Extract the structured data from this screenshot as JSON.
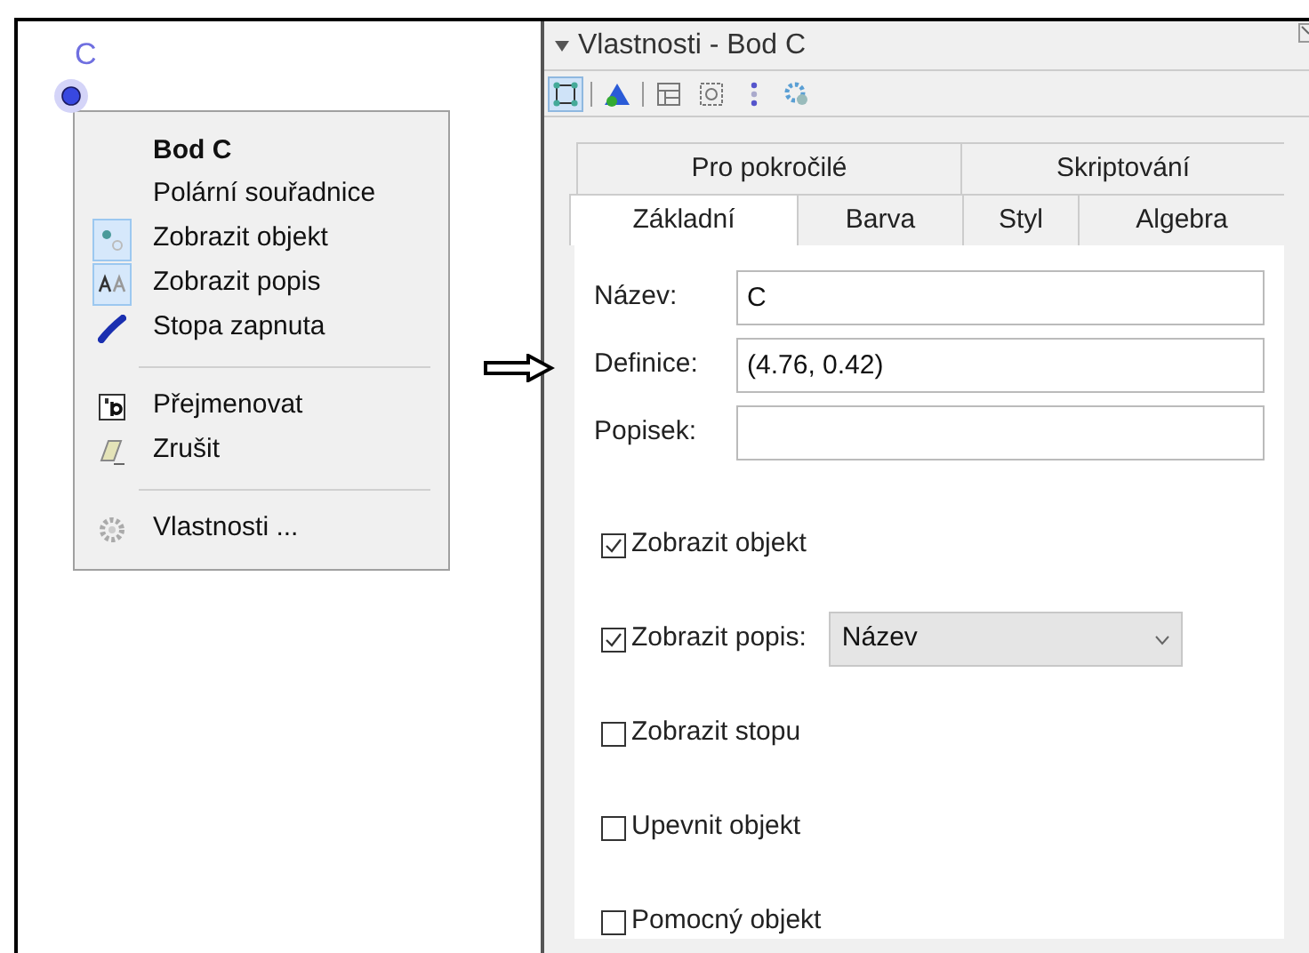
{
  "canvas": {
    "point_label": "C"
  },
  "context_menu": {
    "items": [
      {
        "kind": "title",
        "label": "Bod C"
      },
      {
        "kind": "plain",
        "label": "Polární souřadnice"
      },
      {
        "kind": "toggle",
        "label": "Zobrazit objekt",
        "checked": true
      },
      {
        "kind": "toggle",
        "label": "Zobrazit popis",
        "checked": true
      },
      {
        "kind": "toggle",
        "label": "Stopa zapnuta",
        "checked": false
      },
      {
        "kind": "separator"
      },
      {
        "kind": "action",
        "label": "Přejmenovat"
      },
      {
        "kind": "action",
        "label": "Zrušit"
      },
      {
        "kind": "separator"
      },
      {
        "kind": "action",
        "label": "Vlastnosti ..."
      }
    ]
  },
  "properties": {
    "title": "Vlastnosti - Bod C",
    "toolbar": [
      {
        "selected": true
      },
      {
        "selected": false
      },
      {
        "selected": false
      },
      {
        "selected": false
      },
      {
        "selected": false
      },
      {
        "selected": false
      }
    ],
    "tab_rows": [
      [
        {
          "label": "Pro pokročilé",
          "selected": false
        },
        {
          "label": "Skriptování",
          "selected": false
        }
      ],
      [
        {
          "label": "Základní",
          "selected": true
        },
        {
          "label": "Barva",
          "selected": false
        },
        {
          "label": "Styl",
          "selected": false
        },
        {
          "label": "Algebra",
          "selected": false
        }
      ]
    ],
    "fields": [
      {
        "label": "Název:",
        "value": "C"
      },
      {
        "label": "Definice:",
        "value": "(4.76, 0.42)"
      },
      {
        "label": "Popisek:"
      }
    ],
    "checkboxes": [
      {
        "label": "Zobrazit objekt",
        "checked": true
      },
      {
        "label": "Zobrazit popis:",
        "checked": true,
        "dropdown": "Název"
      },
      {
        "label": "Zobrazit stopu",
        "checked": false
      },
      {
        "label": "Upevnit objekt",
        "checked": false
      },
      {
        "label": "Pomocný objekt",
        "checked": false
      }
    ]
  }
}
